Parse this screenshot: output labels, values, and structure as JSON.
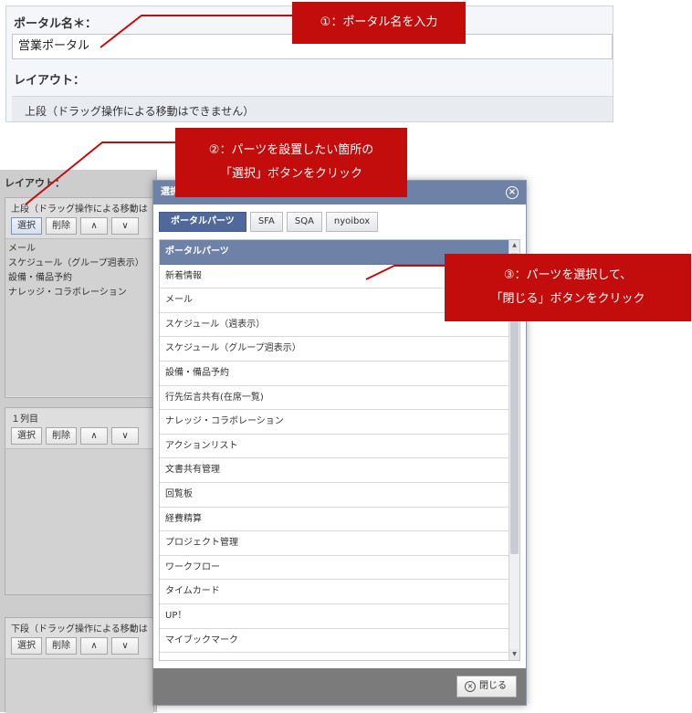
{
  "form": {
    "portal_name_label": "ポータル名＊：",
    "portal_name_value": "営業ポータル",
    "layout_label": "レイアウト：",
    "upper_section_label": "上段（ドラッグ操作による移動はできません）"
  },
  "callouts": {
    "c1": "①：ポータル名を入力",
    "c2_line1": "②：パーツを設置したい箇所の",
    "c2_line2": "「選択」ボタンをクリック",
    "c3_line1": "③：パーツを選択して、",
    "c3_line2": "「閉じる」ボタンをクリック"
  },
  "layout_panel": {
    "title": "レイアウト：",
    "sections": [
      {
        "head": "上段（ドラッグ操作による移動は",
        "items": [
          "メール",
          "スケジュール（グループ週表示）",
          "設備・備品予約",
          "ナレッジ・コラボレーション"
        ]
      },
      {
        "head": "１列目",
        "items": []
      },
      {
        "head": "下段（ドラッグ操作による移動は",
        "items": []
      }
    ],
    "buttons": {
      "select": "選択",
      "delete": "削除",
      "up": "∧",
      "down": "∨"
    }
  },
  "modal": {
    "title": "選択",
    "tabs": [
      "ポータルパーツ",
      "SFA",
      "SQA",
      "nyoibox"
    ],
    "list_header": "ポータルパーツ",
    "items": [
      "新着情報",
      "メール",
      "スケジュール（週表示）",
      "スケジュール（グループ週表示）",
      "設備・備品予約",
      "行先伝言共有(在席一覧)",
      "ナレッジ・コラボレーション",
      "アクションリスト",
      "文書共有管理",
      "回覧板",
      "経費精算",
      "プロジェクト管理",
      "ワークフロー",
      "タイムカード",
      "UP！",
      "マイブックマーク"
    ],
    "close_label": "閉じる"
  },
  "colors": {
    "callout": "#c30d0d",
    "modal_header": "#6e82a8",
    "active_tab": "#4f6a9a"
  }
}
